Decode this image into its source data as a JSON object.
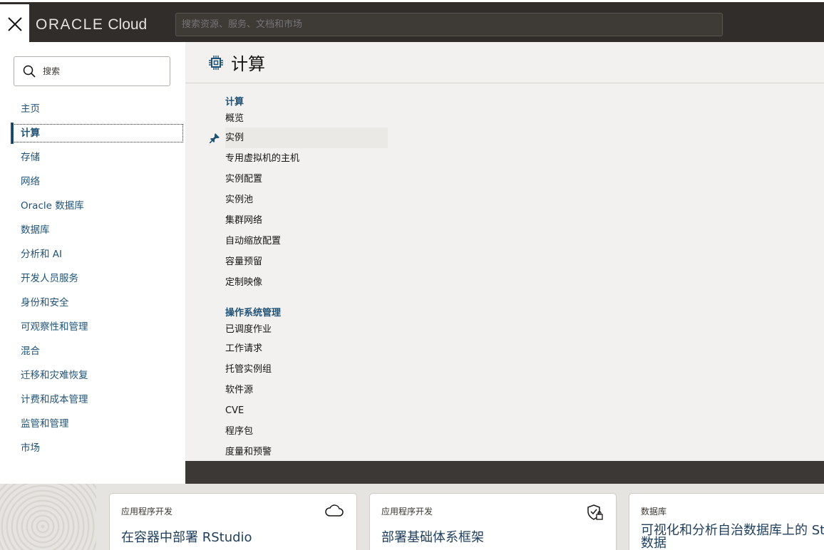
{
  "topbar": {
    "brand_oracle": "ORACLE",
    "brand_cloud": "Cloud",
    "search_placeholder": "搜索资源、服务、文档和市场"
  },
  "sidebar": {
    "search_placeholder": "搜索",
    "items": [
      {
        "label": "主页"
      },
      {
        "label": "计算",
        "active": true
      },
      {
        "label": "存储"
      },
      {
        "label": "网络"
      },
      {
        "label": "Oracle 数据库"
      },
      {
        "label": "数据库"
      },
      {
        "label": "分析和 AI"
      },
      {
        "label": "开发人员服务"
      },
      {
        "label": "身份和安全"
      },
      {
        "label": "可观察性和管理"
      },
      {
        "label": "混合"
      },
      {
        "label": "迁移和灾难恢复"
      },
      {
        "label": "计费和成本管理"
      },
      {
        "label": "监管和管理"
      },
      {
        "label": "市场"
      }
    ]
  },
  "content": {
    "title": "计算",
    "title_icon": "cpu-chip-icon",
    "groups": [
      {
        "title": "计算",
        "items": [
          "概览",
          "实例",
          "专用虚拟机的主机",
          "实例配置",
          "实例池",
          "集群网络",
          "自动缩放配置",
          "容量预留",
          "定制映像"
        ]
      },
      {
        "title": "操作系统管理",
        "items": [
          "已调度作业",
          "工作请求",
          "托管实例组",
          "软件源",
          "CVE",
          "程序包",
          "度量和预警"
        ]
      }
    ],
    "pinned_item": "实例"
  },
  "cards": [
    {
      "category": "应用程序开发",
      "title": "在容器中部署 RStudio",
      "icon": "cloud-icon"
    },
    {
      "category": "应用程序开发",
      "title": "部署基础体系框架",
      "icon": "shield-lock-icon"
    },
    {
      "category": "数据库",
      "title": "可视化和分析自治数据库上的 St",
      "title_line2": "数据"
    }
  ],
  "colors": {
    "topbar_bg": "#312d2a",
    "accent": "#1f5276",
    "content_bg": "#f2f1ef"
  }
}
